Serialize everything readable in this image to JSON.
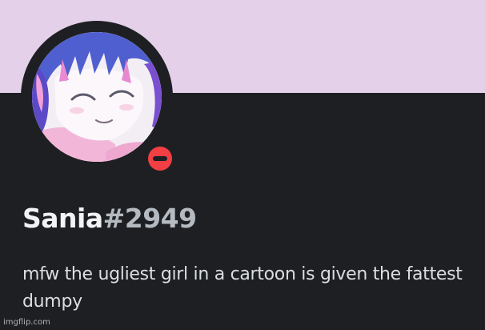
{
  "profile": {
    "username": "Sania",
    "discriminator": "#2949",
    "status": "do-not-disturb",
    "bio": "mfw the ugliest girl in a cartoon is given the fattest dumpy"
  },
  "colors": {
    "banner": "#e5d0ea",
    "background": "#1e1f22",
    "status": "#f23f43",
    "username": "#f2f3f5",
    "discriminator": "#b5bac1",
    "bio": "#dbdee1"
  },
  "watermark": {
    "text": "imgflip.com"
  }
}
